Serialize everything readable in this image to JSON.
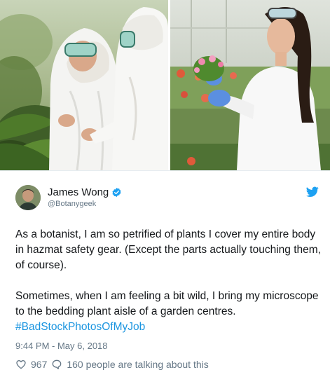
{
  "tweet": {
    "author": {
      "display_name": "James Wong",
      "handle": "@Botanygeek",
      "verified": true
    },
    "text_paragraph_1": "As a botanist, I am so petrified of plants I cover my entire body in hazmat safety gear. (Except the parts actually touching them, of course).",
    "text_paragraph_2_prefix": "Sometimes, when I am feeling a bit wild, I bring my microscope to the bedding plant aisle of a garden centres. ",
    "hashtag": "#BadStockPhotosOfMyJob",
    "timestamp": "9:44 PM - May 6, 2018",
    "likes_count": "967",
    "conversation_text": "160 people are talking about this"
  },
  "icons": {
    "verified": "verified-badge-icon",
    "brand": "twitter-bird-icon",
    "like": "heart-outline-icon",
    "reply": "speech-bubble-icon"
  },
  "colors": {
    "link_blue": "#1b95e0",
    "verified_blue": "#1da1f2",
    "text_primary": "#14171a",
    "text_secondary": "#657786"
  }
}
